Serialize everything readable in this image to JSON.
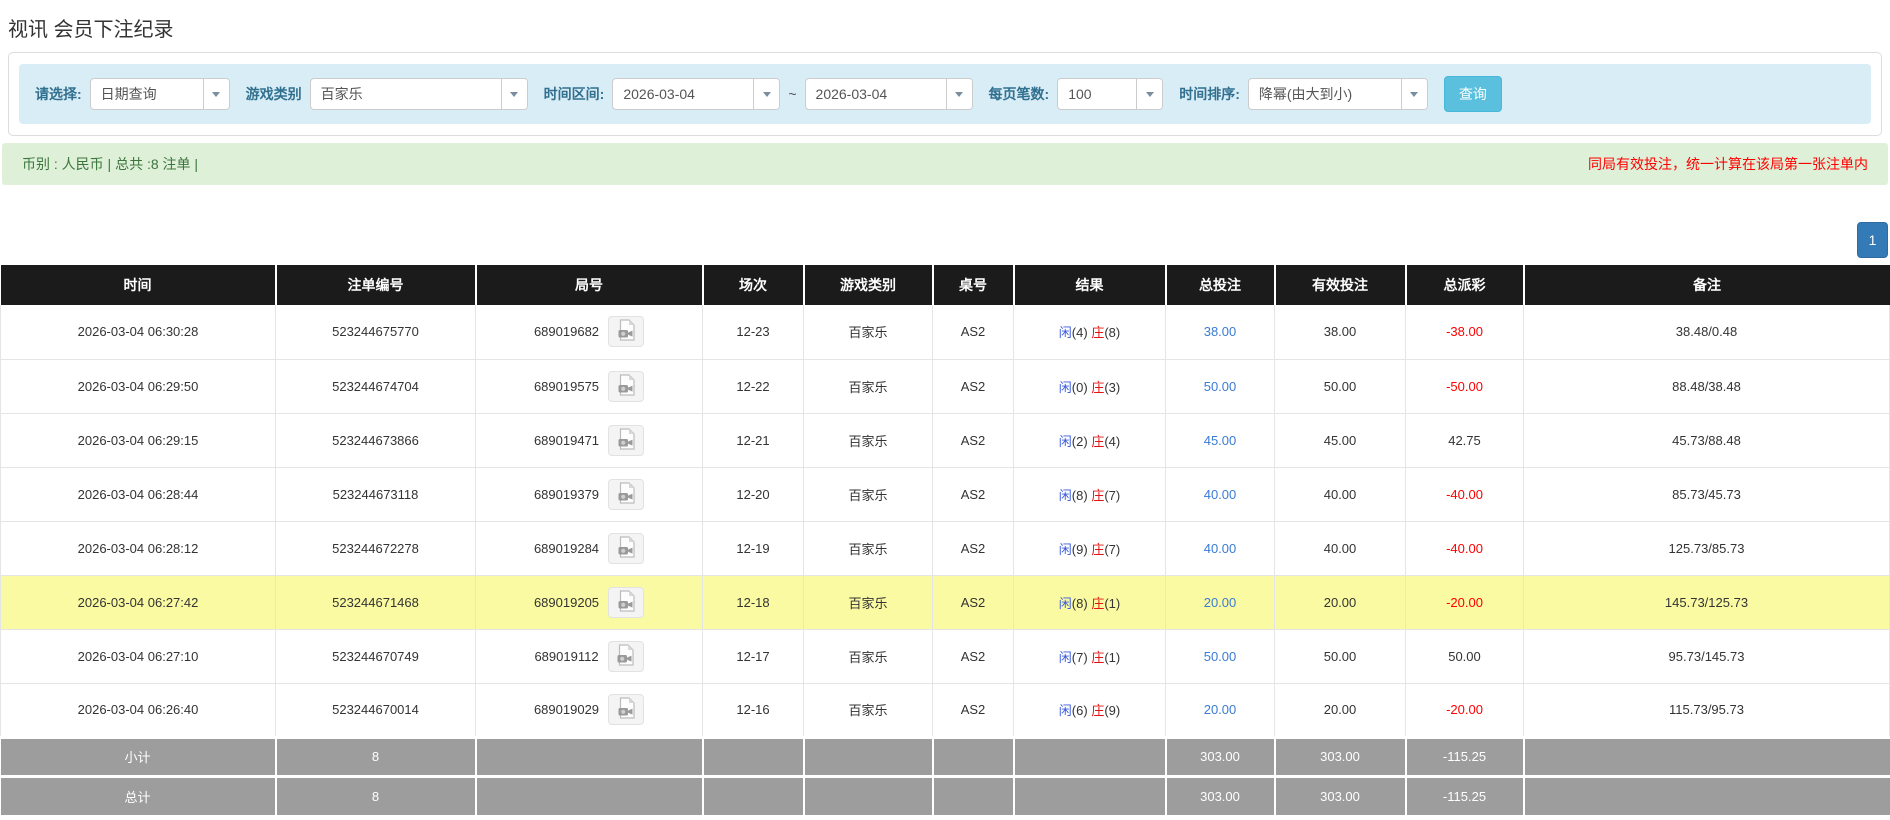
{
  "page_title": "视讯 会员下注纪录",
  "filters": {
    "select_label": "请选择:",
    "select_value": "日期查询",
    "game_type_label": "游戏类别",
    "game_type_value": "百家乐",
    "time_range_label": "时间区间:",
    "date_from": "2026-03-04",
    "range_separator": "~",
    "date_to": "2026-03-04",
    "per_page_label": "每页笔数:",
    "per_page_value": "100",
    "sort_label": "时间排序:",
    "sort_value": "降幂(由大到小)",
    "search_button": "查询"
  },
  "info_bar": {
    "left_text": "币别 : 人民币 | 总共 :8 注单 |",
    "right_text": "同局有效投注，统一计算在该局第一张注单内"
  },
  "pagination": {
    "current_page": "1"
  },
  "table": {
    "headers": [
      "时间",
      "注单编号",
      "局号",
      "场次",
      "游戏类别",
      "桌号",
      "结果",
      "总投注",
      "有效投注",
      "总派彩",
      "备注"
    ],
    "rows": [
      {
        "time": "2026-03-04 06:30:28",
        "bet_id": "523244675770",
        "round_id": "689019682",
        "session": "12-23",
        "game": "百家乐",
        "table_no": "AS2",
        "result": {
          "player": "闲",
          "player_count": "(4)",
          "banker": "庄",
          "banker_count": "(8)"
        },
        "total_bet": "38.00",
        "valid_bet": "38.00",
        "payout": "-38.00",
        "note": "38.48/0.48",
        "highlighted": false
      },
      {
        "time": "2026-03-04 06:29:50",
        "bet_id": "523244674704",
        "round_id": "689019575",
        "session": "12-22",
        "game": "百家乐",
        "table_no": "AS2",
        "result": {
          "player": "闲",
          "player_count": "(0)",
          "banker": "庄",
          "banker_count": "(3)"
        },
        "total_bet": "50.00",
        "valid_bet": "50.00",
        "payout": "-50.00",
        "note": "88.48/38.48",
        "highlighted": false
      },
      {
        "time": "2026-03-04 06:29:15",
        "bet_id": "523244673866",
        "round_id": "689019471",
        "session": "12-21",
        "game": "百家乐",
        "table_no": "AS2",
        "result": {
          "player": "闲",
          "player_count": "(2)",
          "banker": "庄",
          "banker_count": "(4)"
        },
        "total_bet": "45.00",
        "valid_bet": "45.00",
        "payout": "42.75",
        "note": "45.73/88.48",
        "highlighted": false
      },
      {
        "time": "2026-03-04 06:28:44",
        "bet_id": "523244673118",
        "round_id": "689019379",
        "session": "12-20",
        "game": "百家乐",
        "table_no": "AS2",
        "result": {
          "player": "闲",
          "player_count": "(8)",
          "banker": "庄",
          "banker_count": "(7)"
        },
        "total_bet": "40.00",
        "valid_bet": "40.00",
        "payout": "-40.00",
        "note": "85.73/45.73",
        "highlighted": false
      },
      {
        "time": "2026-03-04 06:28:12",
        "bet_id": "523244672278",
        "round_id": "689019284",
        "session": "12-19",
        "game": "百家乐",
        "table_no": "AS2",
        "result": {
          "player": "闲",
          "player_count": "(9)",
          "banker": "庄",
          "banker_count": "(7)"
        },
        "total_bet": "40.00",
        "valid_bet": "40.00",
        "payout": "-40.00",
        "note": "125.73/85.73",
        "highlighted": false
      },
      {
        "time": "2026-03-04 06:27:42",
        "bet_id": "523244671468",
        "round_id": "689019205",
        "session": "12-18",
        "game": "百家乐",
        "table_no": "AS2",
        "result": {
          "player": "闲",
          "player_count": "(8)",
          "banker": "庄",
          "banker_count": "(1)"
        },
        "total_bet": "20.00",
        "valid_bet": "20.00",
        "payout": "-20.00",
        "note": "145.73/125.73",
        "highlighted": true
      },
      {
        "time": "2026-03-04 06:27:10",
        "bet_id": "523244670749",
        "round_id": "689019112",
        "session": "12-17",
        "game": "百家乐",
        "table_no": "AS2",
        "result": {
          "player": "闲",
          "player_count": "(7)",
          "banker": "庄",
          "banker_count": "(1)"
        },
        "total_bet": "50.00",
        "valid_bet": "50.00",
        "payout": "50.00",
        "note": "95.73/145.73",
        "highlighted": false
      },
      {
        "time": "2026-03-04 06:26:40",
        "bet_id": "523244670014",
        "round_id": "689019029",
        "session": "12-16",
        "game": "百家乐",
        "table_no": "AS2",
        "result": {
          "player": "闲",
          "player_count": "(6)",
          "banker": "庄",
          "banker_count": "(9)"
        },
        "total_bet": "20.00",
        "valid_bet": "20.00",
        "payout": "-20.00",
        "note": "115.73/95.73",
        "highlighted": false
      }
    ],
    "subtotal": {
      "label": "小计",
      "count": "8",
      "total_bet": "303.00",
      "valid_bet": "303.00",
      "payout": "-115.25"
    },
    "total": {
      "label": "总计",
      "count": "8",
      "total_bet": "303.00",
      "valid_bet": "303.00",
      "payout": "-115.25"
    }
  },
  "colors": {
    "filter_bar_bg": "#d9edf7",
    "filter_label": "#31708f",
    "search_button_bg": "#5bc0de",
    "info_bar_bg": "#dff0d8",
    "info_text_green": "#3c763d",
    "notice_red": "#ff0000",
    "table_header_bg": "#1b1b1b",
    "highlight_yellow": "#fafaa2",
    "summary_bg": "#9d9d9d",
    "bet_link_blue": "#3a7bd5",
    "player_blue": "#3b5bdb",
    "banker_red": "#e01414",
    "pagination_blue": "#337ab7"
  }
}
